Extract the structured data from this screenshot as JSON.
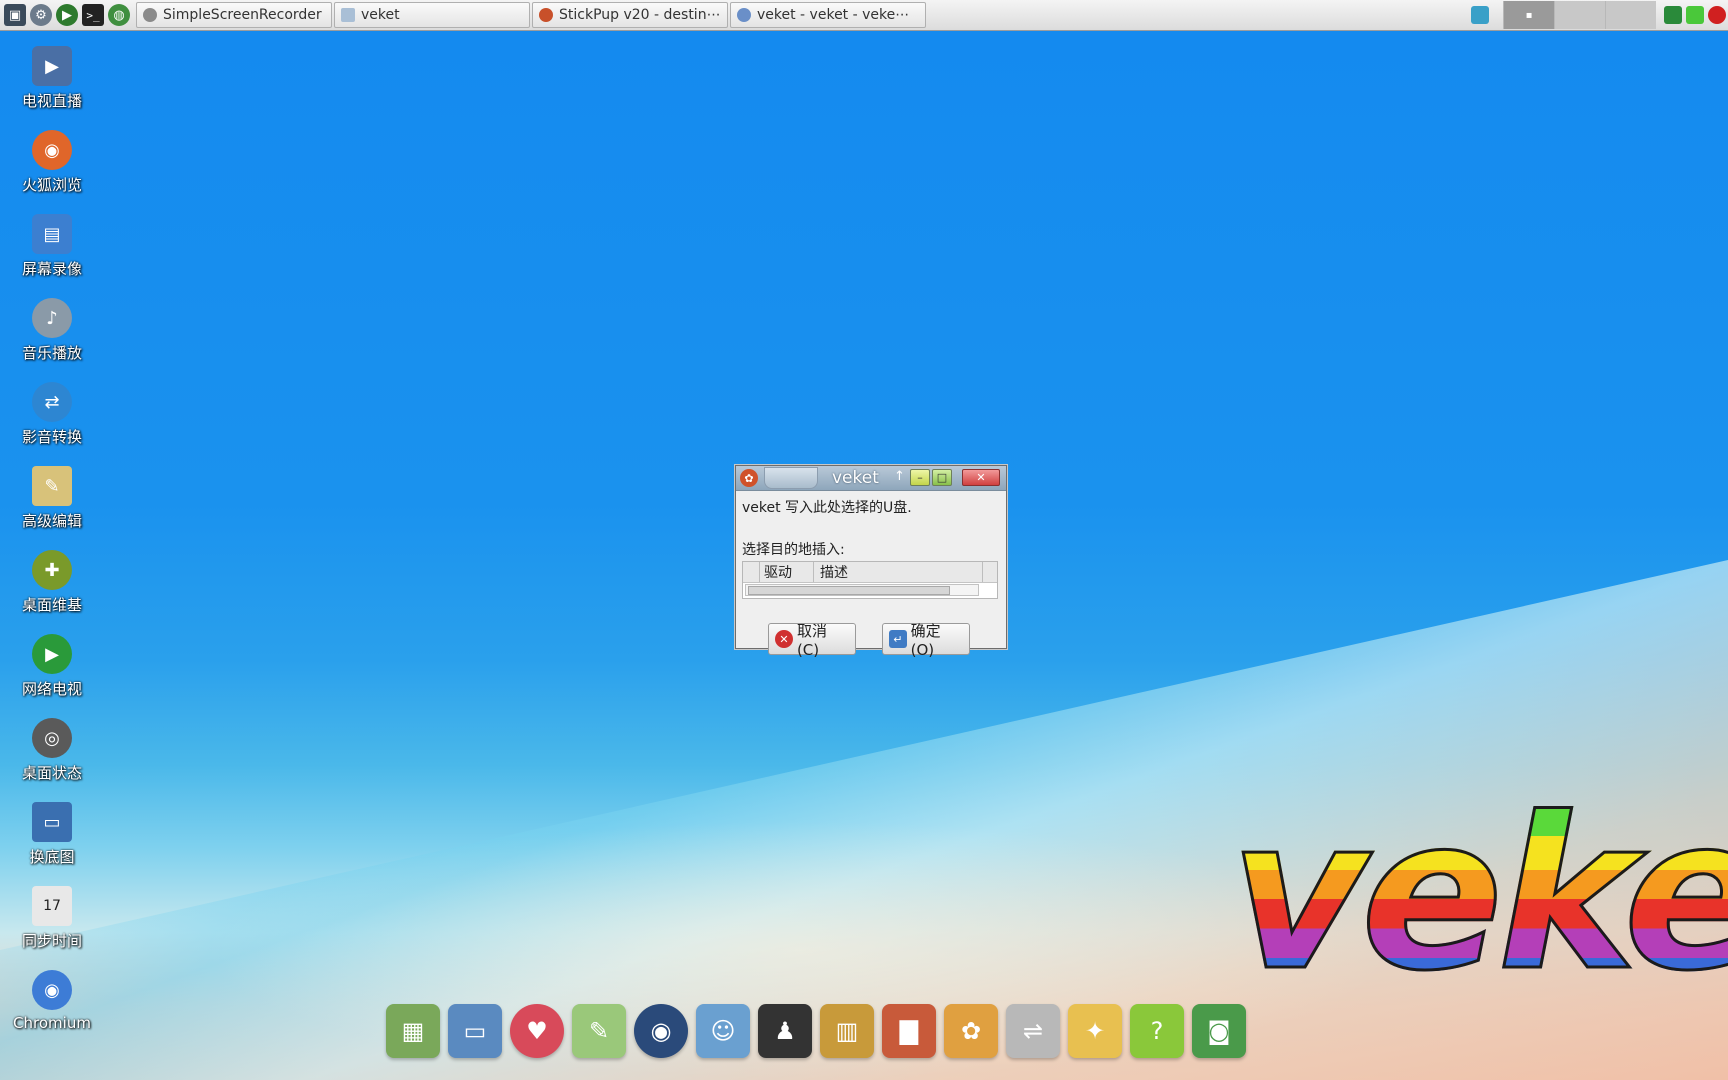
{
  "taskbar": {
    "quick_launch": [
      "monitor-icon",
      "settings-icon",
      "play-icon",
      "terminal-icon",
      "globe-icon"
    ],
    "tasks": [
      {
        "label": "SimpleScreenRecorder",
        "icon": "recorder-icon",
        "color": "#8a8a8a"
      },
      {
        "label": "veket",
        "icon": "folder-icon",
        "color": "#a9bfd6"
      },
      {
        "label": "StickPup  v20 - destin⋯",
        "icon": "stickpup-icon",
        "color": "#c8502a"
      },
      {
        "label": "veket - veket - veke⋯",
        "icon": "veket-icon",
        "color": "#6a8fc8"
      }
    ]
  },
  "desktop_icons": [
    {
      "label": "电视直播",
      "icon": "tv-icon",
      "color": "#4a6fa5"
    },
    {
      "label": "火狐浏览",
      "icon": "firefox-icon",
      "color": "#e0662a"
    },
    {
      "label": "屏幕录像",
      "icon": "screen-record-icon",
      "color": "#3c7fd0"
    },
    {
      "label": "音乐播放",
      "icon": "speaker-icon",
      "color": "#8a9aa8"
    },
    {
      "label": "影音转换",
      "icon": "media-convert-icon",
      "color": "#2d86d2"
    },
    {
      "label": "高级编辑",
      "icon": "text-editor-icon",
      "color": "#d8c27a"
    },
    {
      "label": "桌面维基",
      "icon": "wiki-icon",
      "color": "#7a9a2a"
    },
    {
      "label": "网络电视",
      "icon": "play-icon",
      "color": "#2a9a3a"
    },
    {
      "label": "桌面状态",
      "icon": "status-icon",
      "color": "#5a5a5a"
    },
    {
      "label": "换底图",
      "icon": "wallpaper-icon",
      "color": "#3a6fb0"
    },
    {
      "label": "同步时间",
      "icon": "calendar-icon",
      "color": "#e8e8e8"
    },
    {
      "label": "Chromium",
      "icon": "chromium-icon",
      "color": "#3d7cd6"
    }
  ],
  "dialog": {
    "title": "veket",
    "message": "veket 写入此处选择的U盘.",
    "prompt": "选择目的地插入:",
    "columns": [
      "驱动",
      "描述"
    ],
    "cancel_label": "取消(C)",
    "ok_label": "确定(O)"
  },
  "logo_text": "veke",
  "dock": [
    {
      "icon": "files-icon",
      "color": "#7aa85a"
    },
    {
      "icon": "computer-icon",
      "color": "#5a8ac0"
    },
    {
      "icon": "pet-icon",
      "color": "#d84a5a"
    },
    {
      "icon": "editor-icon",
      "color": "#9ac87a"
    },
    {
      "icon": "media-player-icon",
      "color": "#2a4a7a"
    },
    {
      "icon": "users-icon",
      "color": "#6aa0d0"
    },
    {
      "icon": "penguin-icon",
      "color": "#333333"
    },
    {
      "icon": "book-icon",
      "color": "#c89a3a"
    },
    {
      "icon": "chart-icon",
      "color": "#c85a3a"
    },
    {
      "icon": "paint-icon",
      "color": "#e0a040"
    },
    {
      "icon": "usb-icon",
      "color": "#b8b8b8"
    },
    {
      "icon": "veket-app-icon",
      "color": "#e8c050"
    },
    {
      "icon": "help-icon",
      "color": "#8ac83a"
    },
    {
      "icon": "camera-icon",
      "color": "#4a9a4a"
    }
  ]
}
